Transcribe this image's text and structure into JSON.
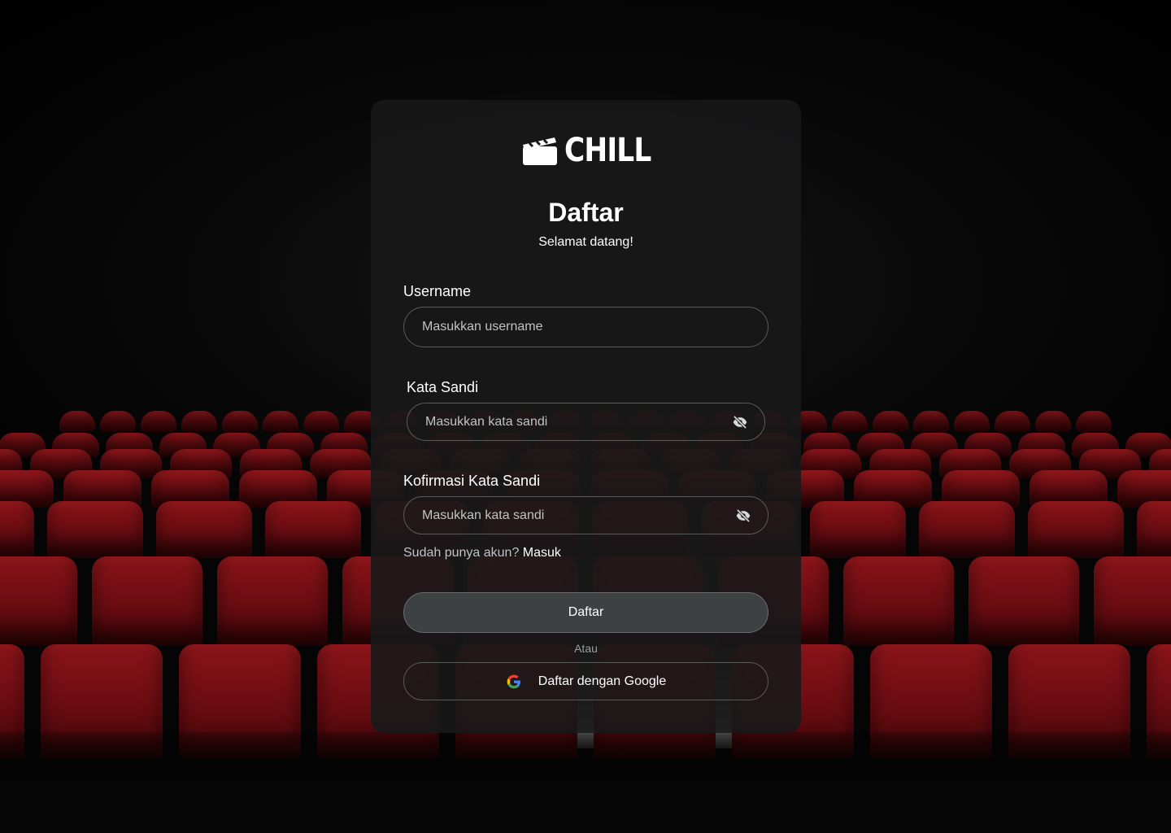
{
  "brand": {
    "name": "CHILL",
    "logo_icon": "clapperboard-icon"
  },
  "form": {
    "title": "Daftar",
    "subtitle": "Selamat datang!",
    "username": {
      "label": "Username",
      "placeholder": "Masukkan username"
    },
    "password": {
      "label": "Kata Sandi",
      "placeholder": "Masukkan kata sandi",
      "toggle_icon": "eye-off-icon"
    },
    "confirm_password": {
      "label": "Kofirmasi Kata Sandi",
      "placeholder": "Masukkan kata sandi",
      "toggle_icon": "eye-off-icon"
    },
    "login_prompt": "Sudah punya akun?",
    "login_link": "Masuk",
    "submit_label": "Daftar",
    "divider_text": "Atau",
    "google_label": "Daftar dengan Google",
    "google_icon": "google-icon"
  },
  "colors": {
    "card_bg": "#181819",
    "field_border": "#5a5a5d",
    "primary_button_bg": "#3d4142",
    "placeholder_text": "#c1c2c4",
    "seat_red": "#8a1419"
  }
}
